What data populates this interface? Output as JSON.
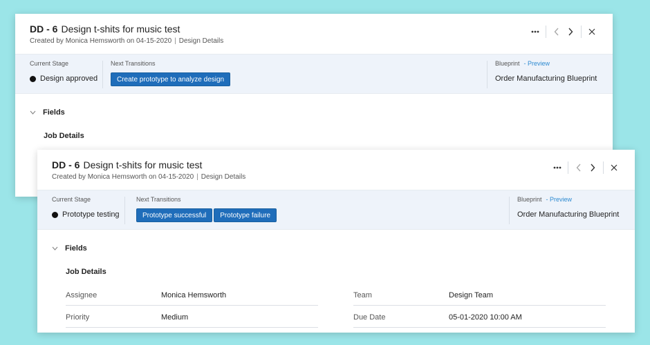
{
  "back_card": {
    "record_id": "DD - 6",
    "title": "Design t-shits for music test",
    "created_by_prefix": "Created by",
    "created_by": "Monica Hemsworth",
    "on_prefix": "on",
    "created_date": "04-15-2020",
    "separator": "|",
    "layout": "Design Details",
    "current_stage_label": "Current Stage",
    "current_stage": "Design approved",
    "next_transitions_label": "Next Transitions",
    "transitions": [
      "Create prototype to analyze design"
    ],
    "blueprint_label": "Blueprint",
    "preview_link": "- Preview",
    "blueprint_name": "Order Manufacturing Blueprint",
    "fields_label": "Fields",
    "job_details_label": "Job Details"
  },
  "front_card": {
    "record_id": "DD - 6",
    "title": "Design t-shits for music test",
    "created_by_prefix": "Created by",
    "created_by": "Monica Hemsworth",
    "on_prefix": "on",
    "created_date": "04-15-2020",
    "separator": "|",
    "layout": "Design Details",
    "current_stage_label": "Current Stage",
    "current_stage": "Prototype testing",
    "next_transitions_label": "Next Transitions",
    "transitions": [
      "Prototype successful",
      "Prototype failure"
    ],
    "blueprint_label": "Blueprint",
    "preview_link": "- Preview",
    "blueprint_name": "Order Manufacturing Blueprint",
    "fields_label": "Fields",
    "job_details_label": "Job Details",
    "details": [
      {
        "label": "Assignee",
        "value": "Monica Hemsworth"
      },
      {
        "label": "Team",
        "value": "Design Team"
      },
      {
        "label": "Priority",
        "value": "Medium"
      },
      {
        "label": "Due Date",
        "value": "05-01-2020 10:00 AM"
      }
    ]
  },
  "icons": {
    "more": "more-horizontal-icon",
    "prev": "chevron-left-icon",
    "next": "chevron-right-icon",
    "close": "close-icon",
    "collapse": "chevron-down-icon"
  },
  "colors": {
    "background": "#9be5e8",
    "band": "#eef3fa",
    "button": "#1f6dba",
    "link": "#2d8ad1"
  }
}
